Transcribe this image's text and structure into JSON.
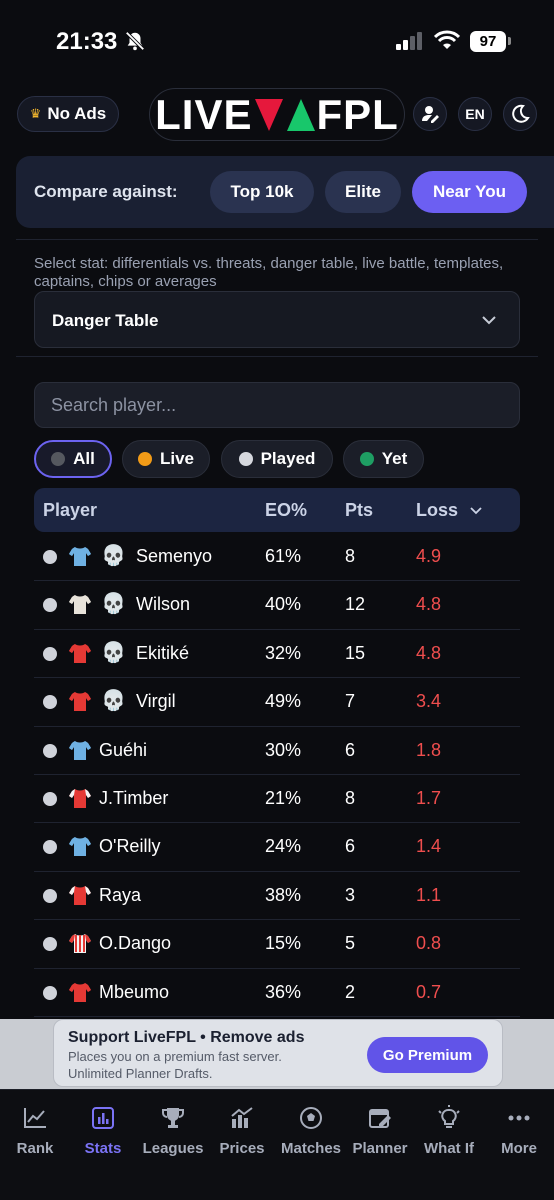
{
  "status": {
    "time": "21:33",
    "battery": "97"
  },
  "header": {
    "no_ads_label": "No Ads",
    "logo_left": "LIVE",
    "logo_right": "FPL",
    "lang": "EN"
  },
  "compare": {
    "label": "Compare against:",
    "options": [
      "Top 10k",
      "Elite",
      "Near You"
    ],
    "active": "Near You"
  },
  "stat_select": {
    "description": "Select stat: differentials vs. threats, danger table, live battle, templates, captains, chips or averages",
    "value": "Danger Table"
  },
  "search": {
    "placeholder": "Search player..."
  },
  "filters": [
    {
      "label": "All",
      "color": "#55585f",
      "active": true
    },
    {
      "label": "Live",
      "color": "#f29b17",
      "active": false
    },
    {
      "label": "Played",
      "color": "#d6d8de",
      "active": false
    },
    {
      "label": "Yet",
      "color": "#1e9e63",
      "active": false
    }
  ],
  "table": {
    "headers": {
      "player": "Player",
      "eo": "EO%",
      "pts": "Pts",
      "loss": "Loss"
    },
    "sort_column": "Loss",
    "rows": [
      {
        "name": "Semenyo",
        "kit": "sky-blue",
        "danger": true,
        "eo": "61%",
        "pts": "8",
        "loss": "4.9"
      },
      {
        "name": "Wilson",
        "kit": "white",
        "danger": true,
        "eo": "40%",
        "pts": "12",
        "loss": "4.8"
      },
      {
        "name": "Ekitiké",
        "kit": "red",
        "danger": true,
        "eo": "32%",
        "pts": "15",
        "loss": "4.8"
      },
      {
        "name": "Virgil",
        "kit": "red",
        "danger": true,
        "eo": "49%",
        "pts": "7",
        "loss": "3.4"
      },
      {
        "name": "Guéhi",
        "kit": "sky-blue",
        "danger": false,
        "eo": "30%",
        "pts": "6",
        "loss": "1.8"
      },
      {
        "name": "J.Timber",
        "kit": "red-white-sleeves",
        "danger": false,
        "eo": "21%",
        "pts": "8",
        "loss": "1.7"
      },
      {
        "name": "O'Reilly",
        "kit": "sky-blue",
        "danger": false,
        "eo": "24%",
        "pts": "6",
        "loss": "1.4"
      },
      {
        "name": "Raya",
        "kit": "red-white-sleeves",
        "danger": false,
        "eo": "38%",
        "pts": "3",
        "loss": "1.1"
      },
      {
        "name": "O.Dango",
        "kit": "red-white-stripes",
        "danger": false,
        "eo": "15%",
        "pts": "5",
        "loss": "0.8"
      },
      {
        "name": "Mbeumo",
        "kit": "red",
        "danger": false,
        "eo": "36%",
        "pts": "2",
        "loss": "0.7"
      }
    ]
  },
  "ad": {
    "title": "Support LiveFPL • Remove ads",
    "line1": "Places you on a premium fast server.",
    "line2": "Unlimited Planner Drafts.",
    "button": "Go Premium"
  },
  "nav": [
    {
      "label": "Rank",
      "icon": "line-chart-icon",
      "active": false
    },
    {
      "label": "Stats",
      "icon": "bar-chart-icon",
      "active": true
    },
    {
      "label": "Leagues",
      "icon": "trophy-icon",
      "active": false
    },
    {
      "label": "Prices",
      "icon": "price-chart-icon",
      "active": false
    },
    {
      "label": "Matches",
      "icon": "football-icon",
      "active": false
    },
    {
      "label": "Planner",
      "icon": "calendar-edit-icon",
      "active": false
    },
    {
      "label": "What If",
      "icon": "lightbulb-icon",
      "active": false
    },
    {
      "label": "More",
      "icon": "more-dots-icon",
      "active": false
    }
  ],
  "colors": {
    "accent": "#6c5ff2",
    "loss_red": "#ef4e4e",
    "logo_red": "#e6183c",
    "logo_green": "#18c76b"
  }
}
